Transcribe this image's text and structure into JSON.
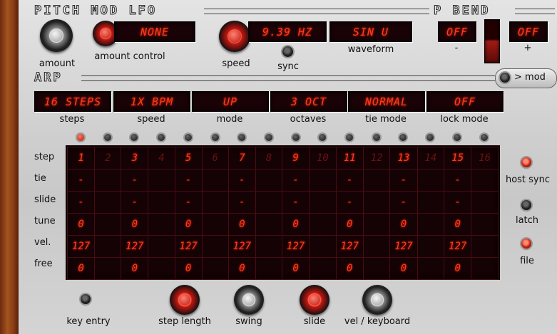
{
  "lfo": {
    "title": "PITCH MOD LFO",
    "amount_display": "NONE",
    "rate_display": "9.39 HZ",
    "waveform_display": "SIN U",
    "labels": {
      "amount": "amount",
      "amount_control": "amount control",
      "speed": "speed",
      "sync": "sync",
      "waveform": "waveform"
    }
  },
  "pbend": {
    "title": "P BEND",
    "minus_display": "OFF",
    "plus_display": "OFF",
    "minus_label": "-",
    "plus_label": "+"
  },
  "arp": {
    "title": "ARP",
    "mod_button": "> mod",
    "settings": [
      {
        "value": "16 STEPS",
        "label": "steps"
      },
      {
        "value": "1X BPM",
        "label": "speed"
      },
      {
        "value": "UP",
        "label": "mode"
      },
      {
        "value": "3 OCT",
        "label": "octaves"
      },
      {
        "value": "NORMAL",
        "label": "tie mode"
      },
      {
        "value": "OFF",
        "label": "lock mode"
      }
    ],
    "row_labels": [
      "step",
      "tie",
      "slide",
      "tune",
      "vel.",
      "free"
    ],
    "steps": [
      "1",
      "2",
      "3",
      "4",
      "5",
      "6",
      "7",
      "8",
      "9",
      "10",
      "11",
      "12",
      "13",
      "14",
      "15",
      "16"
    ],
    "tie": [
      "-",
      "",
      "-",
      "",
      "-",
      "",
      "-",
      "",
      "-",
      "",
      "-",
      "",
      "-",
      "",
      "-",
      ""
    ],
    "slide": [
      "-",
      "",
      "-",
      "",
      "-",
      "",
      "-",
      "",
      "-",
      "",
      "-",
      "",
      "-",
      "",
      "-",
      ""
    ],
    "tune": [
      "0",
      "",
      "0",
      "",
      "0",
      "",
      "0",
      "",
      "0",
      "",
      "0",
      "",
      "0",
      "",
      "0",
      ""
    ],
    "vel": [
      "127",
      "",
      "127",
      "",
      "127",
      "",
      "127",
      "",
      "127",
      "",
      "127",
      "",
      "127",
      "",
      "127",
      ""
    ],
    "free": [
      "0",
      "",
      "0",
      "",
      "0",
      "",
      "0",
      "",
      "0",
      "",
      "0",
      "",
      "0",
      "",
      "0",
      ""
    ],
    "active_step": 1,
    "right_labels": {
      "host_sync": "host sync",
      "latch": "latch",
      "file": "file"
    },
    "bottom_labels": {
      "key_entry": "key entry",
      "step_length": "step length",
      "swing": "swing",
      "slide": "slide",
      "vel_keyboard": "vel / keyboard"
    }
  },
  "colors": {
    "lcd_text": "#ff3a1e",
    "lcd_bg": "#1a0306",
    "accent_red": "#c0190f"
  }
}
